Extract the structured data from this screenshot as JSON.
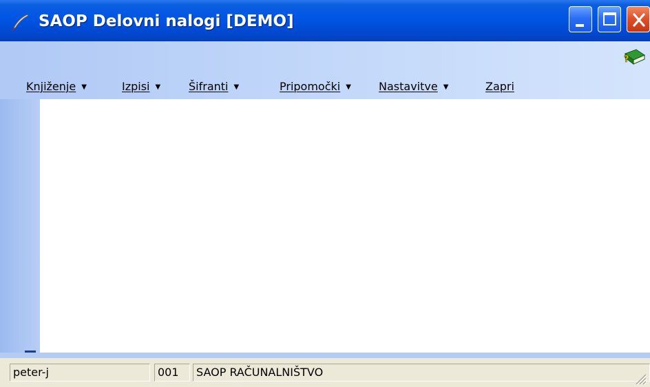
{
  "window": {
    "title": "SAOP Delovni nalogi [DEMO]",
    "icon": "quill-icon",
    "controls": [
      "minimize-icon",
      "maximize-icon",
      "close-icon"
    ]
  },
  "toolbar": {
    "help_icon": "help-book-icon"
  },
  "menu": {
    "items": [
      {
        "label": "Knjiženje",
        "has_dropdown": true
      },
      {
        "label": "Izpisi",
        "has_dropdown": true
      },
      {
        "label": "Šifranti",
        "has_dropdown": true
      },
      {
        "label": "Pripomočki",
        "has_dropdown": true
      },
      {
        "label": "Nastavitve",
        "has_dropdown": true
      },
      {
        "label": "Zapri",
        "has_dropdown": false
      }
    ],
    "dropdown_glyph": "▼"
  },
  "statusbar": {
    "user": "peter-j",
    "company_code": "001",
    "company_name": "SAOP RAČUNALNIŠTVO"
  },
  "colors": {
    "titlebar": "#0055e5",
    "client_background": "#b4ccf4",
    "workspace": "#ffffff",
    "statusbar": "#ece9d8",
    "close_button": "#e0502b"
  }
}
